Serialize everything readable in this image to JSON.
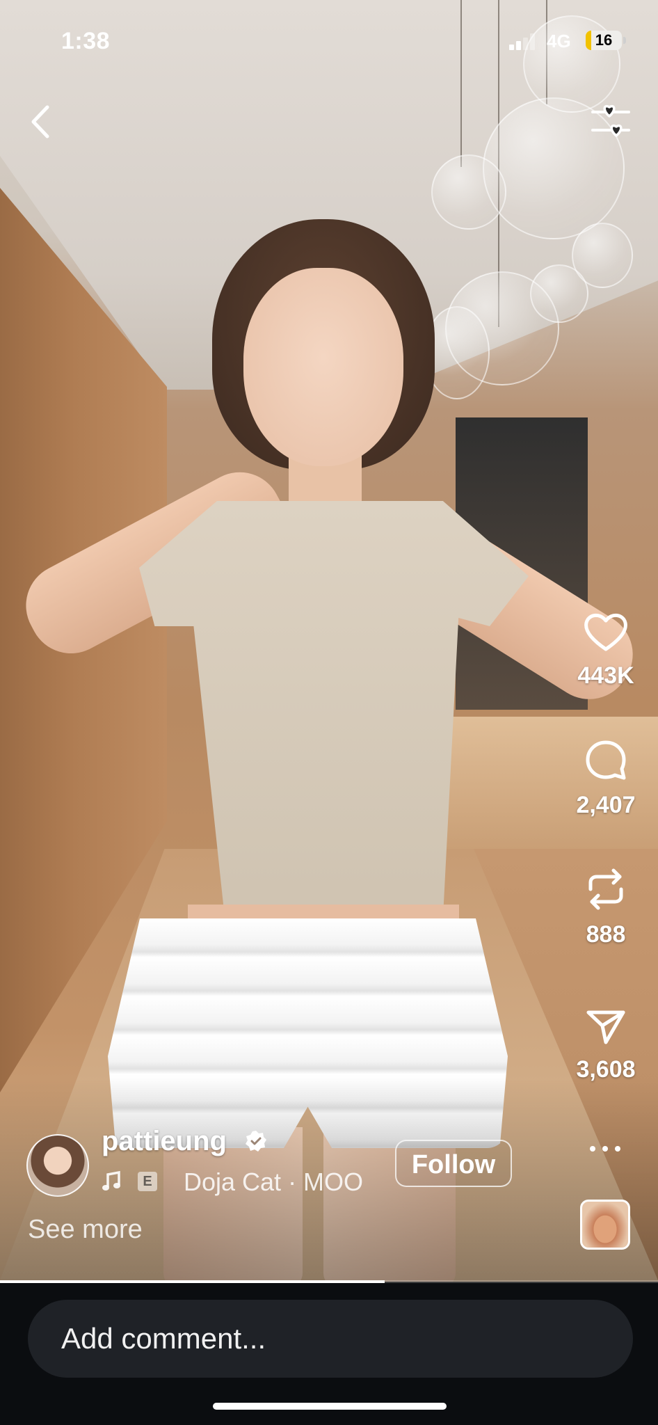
{
  "status_bar": {
    "time": "1:38",
    "network": "4G",
    "battery": "16",
    "battery_color": "#f2c200"
  },
  "top_bar": {
    "back_icon": "chevron-left-icon",
    "filter_icon": "hearts-sliders-icon"
  },
  "actions": {
    "likes": "443K",
    "comments": "2,407",
    "reposts": "888",
    "shares": "3,608"
  },
  "post": {
    "username": "pattieung",
    "verified": true,
    "explicit_badge": "E",
    "song": "Doja Cat · MOO",
    "follow_label": "Follow",
    "see_more": "See more"
  },
  "video": {
    "progress": 0.585
  },
  "comment_bar": {
    "placeholder": "Add comment..."
  }
}
